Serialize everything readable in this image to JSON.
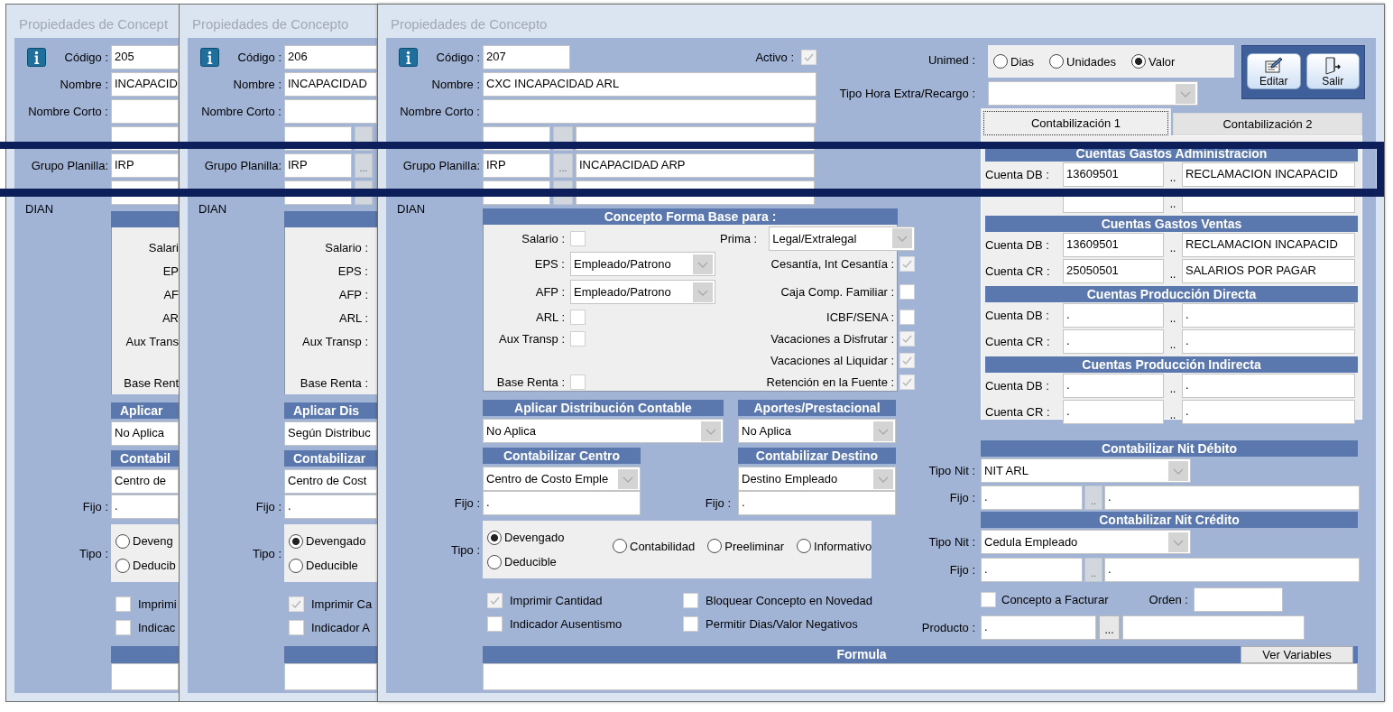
{
  "back_windows": [
    {
      "title": "Propiedades de Concept",
      "codigo": {
        "label": "Código :",
        "value": "205"
      },
      "fields": [
        {
          "kind": "text",
          "label": "Nombre :",
          "value": "INCAPACID"
        },
        {
          "kind": "text",
          "label": "Nombre Corto :"
        },
        {
          "kind": "text"
        },
        {
          "kind": "text",
          "label": "Grupo Planilla:",
          "value": "IRP"
        },
        {
          "kind": "text",
          "label": "DIAN"
        }
      ],
      "base_labels": [
        "Salari",
        "EP",
        "AF",
        "AR",
        "Aux Trans",
        "Base Rent"
      ],
      "aplicar": {
        "title": "Aplicar",
        "value": "No Aplica"
      },
      "centro": {
        "title": "Contabil",
        "value": "Centro de"
      },
      "fijo": {
        "label": "Fijo :",
        "value": "."
      },
      "tipo": {
        "label": "Tipo :",
        "options": [
          {
            "label": "Deveng",
            "selected": false
          },
          {
            "label": "Deducib",
            "selected": false
          }
        ]
      },
      "checks": [
        {
          "label": "Imprimi",
          "checked": false
        },
        {
          "label": "Indicac",
          "checked": false
        }
      ]
    },
    {
      "title": "Propiedades de Concepto",
      "codigo": {
        "label": "Código :",
        "value": "206"
      },
      "fields": [
        {
          "kind": "text",
          "label": "Nombre :",
          "value": "INCAPACIDAD"
        },
        {
          "kind": "text",
          "label": "Nombre Corto :"
        },
        {
          "kind": "lookup"
        },
        {
          "kind": "lookup",
          "label": "Grupo Planilla:",
          "value": "IRP",
          "button": "..."
        },
        {
          "kind": "lookup",
          "label": "DIAN"
        }
      ],
      "base_labels": [
        "Salario :",
        "EPS :",
        "AFP :",
        "ARL :",
        "Aux Transp :",
        "Base Renta :"
      ],
      "aplicar": {
        "title": "Aplicar Dis",
        "value": "Según Distribuc"
      },
      "centro": {
        "title": "Contabilizar",
        "value": "Centro de Cost"
      },
      "fijo": {
        "label": "Fijo :",
        "value": "."
      },
      "tipo": {
        "label": "Tipo :",
        "options": [
          {
            "label": "Devengado",
            "selected": true
          },
          {
            "label": "Deducible",
            "selected": false
          }
        ]
      },
      "checks": [
        {
          "label": "Imprimir Ca",
          "checked": true
        },
        {
          "label": "Indicador A",
          "checked": false
        }
      ]
    }
  ],
  "main_window": {
    "title": "Propiedades de Concepto",
    "codigo": {
      "label": "Código :",
      "value": "207"
    },
    "activo": {
      "label": "Activo :",
      "checked": true
    },
    "fields": [
      {
        "kind": "text",
        "label": "Nombre :",
        "value": "CXC INCAPACIDAD ARL"
      },
      {
        "kind": "text",
        "label": "Nombre Corto :"
      },
      {
        "kind": "lookup"
      },
      {
        "kind": "lookup",
        "label": "Grupo Planilla:",
        "value": "IRP",
        "button": "...",
        "description": "INCAPACIDAD ARP"
      },
      {
        "kind": "lookup",
        "label": "DIAN"
      }
    ],
    "base_panel": {
      "title": "Concepto Forma Base para :",
      "rows": [
        {
          "left": {
            "kind": "checkbox",
            "label": "Salario :",
            "checked": false
          },
          "right": {
            "kind": "select",
            "label": "Prima :",
            "value": "Legal/Extralegal"
          }
        },
        {
          "left": {
            "kind": "select",
            "label": "EPS :",
            "value": "Empleado/Patrono"
          },
          "right": {
            "kind": "checkbox",
            "label": "Cesantía, Int Cesantía :",
            "checked": true
          }
        },
        {
          "left": {
            "kind": "select",
            "label": "AFP :",
            "value": "Empleado/Patrono"
          },
          "right": {
            "kind": "checkbox",
            "label": "Caja Comp. Familiar :",
            "checked": false
          }
        },
        {
          "left": {
            "kind": "checkbox",
            "label": "ARL :",
            "checked": false
          },
          "right": {
            "kind": "checkbox",
            "label": "ICBF/SENA :",
            "checked": false
          }
        },
        {
          "left": {
            "kind": "checkbox",
            "label": "Aux Transp :",
            "checked": false
          },
          "right": {
            "kind": "checkbox",
            "label": "Vacaciones a Disfrutar :",
            "checked": true
          }
        },
        {
          "left": {
            "kind": "blank"
          },
          "right": {
            "kind": "checkbox",
            "label": "Vacaciones al Liquidar :",
            "checked": true
          }
        },
        {
          "left": {
            "kind": "checkbox",
            "label": "Base Renta :",
            "checked": false
          },
          "right": {
            "kind": "checkbox",
            "label": "Retención en la Fuente :",
            "checked": true
          }
        }
      ]
    },
    "aplicar": {
      "title": "Aplicar Distribución Contable",
      "value": "No Aplica"
    },
    "aportes": {
      "title": "Aportes/Prestacional",
      "value": "No Aplica"
    },
    "centro": {
      "title": "Contabilizar Centro",
      "value": "Centro de Costo Emple",
      "fijo_label": "Fijo :",
      "fijo_value": "."
    },
    "destino": {
      "title": "Contabilizar Destino",
      "value": "Destino Empleado",
      "fijo_label": "Fijo :",
      "fijo_value": "."
    },
    "tipo": {
      "label": "Tipo :",
      "options": [
        {
          "label": "Devengado",
          "selected": true
        },
        {
          "label": "Deducible",
          "selected": false
        },
        {
          "label": "Contabilidad",
          "selected": false
        },
        {
          "label": "Preeliminar",
          "selected": false
        },
        {
          "label": "Informativo",
          "selected": false
        }
      ]
    },
    "checks": [
      {
        "label": "Imprimir Cantidad",
        "checked": true
      },
      {
        "label": "Bloquear Concepto en Novedad",
        "checked": false
      },
      {
        "label": "Indicador Ausentismo",
        "checked": false
      },
      {
        "label": "Permitir Dias/Valor Negativos",
        "checked": false
      }
    ],
    "unimed": {
      "label": "Unimed :",
      "options": [
        {
          "label": "Dias",
          "selected": false
        },
        {
          "label": "Unidades",
          "selected": false
        },
        {
          "label": "Valor",
          "selected": true
        }
      ]
    },
    "tipo_hora": {
      "label": "Tipo Hora Extra/Recargo :"
    },
    "buttons": [
      {
        "label": "Editar",
        "kind": "edit"
      },
      {
        "label": "Salir",
        "kind": "exit"
      }
    ],
    "tabs": [
      {
        "label": "Contabilización 1",
        "selected": true
      },
      {
        "label": "Contabilización 2",
        "selected": false
      }
    ],
    "account_sections": [
      {
        "title": "Cuentas Gastos Administracion",
        "rows": [
          {
            "label": "Cuenta DB :",
            "account": "13609501",
            "button": "..",
            "description": "RECLAMACION INCAPACID"
          },
          {
            "button": ".."
          }
        ]
      },
      {
        "title": "Cuentas Gastos Ventas",
        "rows": [
          {
            "label": "Cuenta DB :",
            "account": "13609501",
            "button": "..",
            "description": "RECLAMACION INCAPACID"
          },
          {
            "label": "Cuenta CR :",
            "account": "25050501",
            "button": "..",
            "description": "SALARIOS POR PAGAR"
          }
        ]
      },
      {
        "title": "Cuentas Producción Directa",
        "rows": [
          {
            "label": "Cuenta DB :",
            "account": ".",
            "button": "..",
            "description": "."
          },
          {
            "label": "Cuenta CR :",
            "account": ".",
            "button": "..",
            "description": "."
          }
        ]
      },
      {
        "title": "Cuentas Producción Indirecta",
        "rows": [
          {
            "label": "Cuenta DB :",
            "account": ".",
            "button": "..",
            "description": "."
          },
          {
            "label": "Cuenta CR :",
            "account": ".",
            "button": "..",
            "description": "."
          }
        ]
      }
    ],
    "nit_sections": [
      {
        "title": "Contabilizar Nit Débito",
        "tipo_label": "Tipo Nit :",
        "tipo_value": "NIT ARL",
        "fijo_label": "Fijo :",
        "fijo_value": ".",
        "fijo_button": "..",
        "fijo_description": "."
      },
      {
        "title": "Contabilizar Nit Crédito",
        "tipo_label": "Tipo Nit :",
        "tipo_value": "Cedula Empleado",
        "fijo_label": "Fijo :",
        "fijo_value": ".",
        "fijo_button": "..",
        "fijo_description": "."
      }
    ],
    "facturar": {
      "label": "Concepto a Facturar",
      "checked": false
    },
    "orden": {
      "label": "Orden :"
    },
    "producto": {
      "label": "Producto :",
      "value": ".",
      "button": "..."
    },
    "formula": {
      "title": "Formula",
      "button": "Ver Variables"
    }
  }
}
